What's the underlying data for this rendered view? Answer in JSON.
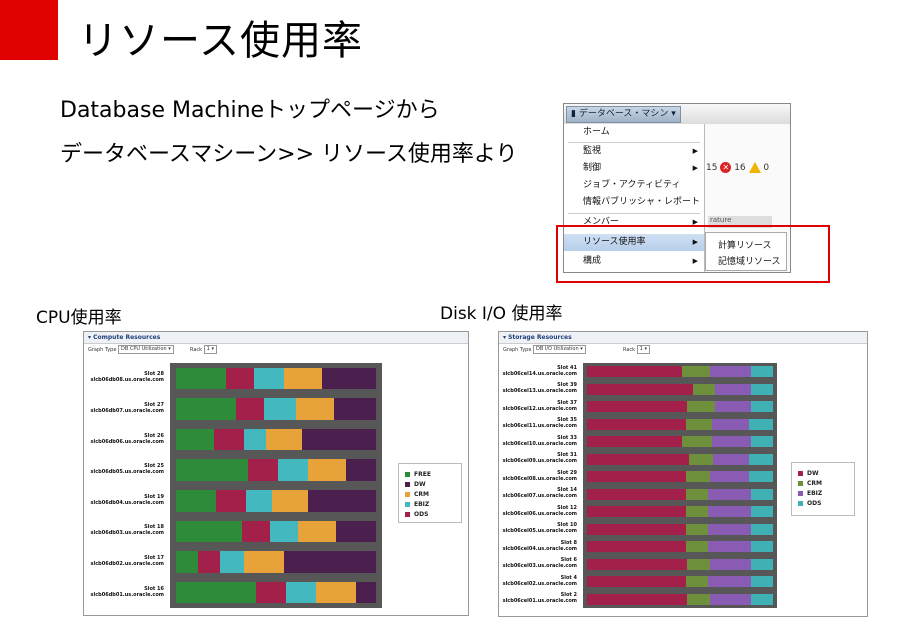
{
  "slide": {
    "title": "リソース使用率",
    "line1": "Database Machineトップページから",
    "line2": "データベースマシーン>> リソース使用率より",
    "cpu_caption": "CPU使用率",
    "disk_caption": "Disk I/O  使用率"
  },
  "menu": {
    "target_button": "データベース・マシン",
    "items": [
      {
        "label": "ホーム",
        "arrow": false
      },
      {
        "label": "監視",
        "arrow": true
      },
      {
        "label": "制御",
        "arrow": true
      },
      {
        "label": "ジョブ・アクティビティ",
        "arrow": false
      },
      {
        "label": "情報パブリッシャ・レポート",
        "arrow": false
      },
      {
        "label": "メンバー",
        "arrow": true
      },
      {
        "label": "リソース使用率",
        "arrow": true
      },
      {
        "label": "構成",
        "arrow": true
      }
    ],
    "submenu": [
      "計算リソース",
      "記憶域リソース"
    ],
    "status_a": "15",
    "status_b": "16",
    "status_c": "0",
    "partial_text": "rature"
  },
  "colors": {
    "accent_red": "#e00000",
    "free": "#2e8b3a",
    "dw": "#4b1f4e",
    "crm": "#e8a23a",
    "ebiz": "#44b8bf",
    "ods": "#a3204b",
    "storage_dw": "#a3204b",
    "storage_crm": "#6e8f3c",
    "storage_ebiz": "#8a5bb3",
    "storage_ods": "#3fb0b4"
  },
  "cpu_panel": {
    "header": "Compute Resources",
    "graph_type_label": "Graph Type",
    "graph_type_value": "DB CPU Utilization",
    "rack_label": "Rack",
    "rack_value": "1",
    "legend": [
      "FREE",
      "DW",
      "CRM",
      "EBIZ",
      "ODS"
    ]
  },
  "disk_panel": {
    "header": "Storage Resources",
    "graph_type_label": "Graph Type",
    "graph_type_value": "DB I/O Utilization",
    "rack_label": "Rack",
    "rack_value": "1",
    "legend": [
      "DW",
      "CRM",
      "EBIZ",
      "ODS"
    ]
  },
  "chart_data": [
    {
      "type": "bar",
      "title": "Compute Resources",
      "orientation": "horizontal-stacked",
      "categories": [
        "Slot 28 slcb06db08.us.oracle.com",
        "Slot 27 slcb06db07.us.oracle.com",
        "Slot 26 slcb06db06.us.oracle.com",
        "Slot 25 slcb06db05.us.oracle.com",
        "Slot 19 slcb06db04.us.oracle.com",
        "Slot 18 slcb06db03.us.oracle.com",
        "Slot 17 slcb06db02.us.oracle.com",
        "Slot 16 slcb06db01.us.oracle.com"
      ],
      "series": [
        {
          "name": "FREE",
          "values": [
            25,
            30,
            19,
            36,
            20,
            33,
            11,
            40
          ]
        },
        {
          "name": "ODS",
          "values": [
            14,
            14,
            15,
            15,
            15,
            14,
            11,
            15
          ]
        },
        {
          "name": "EBIZ",
          "values": [
            15,
            16,
            11,
            15,
            13,
            14,
            12,
            15
          ]
        },
        {
          "name": "CRM",
          "values": [
            19,
            19,
            18,
            19,
            18,
            19,
            20,
            20
          ]
        },
        {
          "name": "DW",
          "values": [
            27,
            21,
            37,
            15,
            34,
            20,
            46,
            10
          ]
        }
      ],
      "xlim": [
        0,
        100
      ],
      "legend_position": "right"
    },
    {
      "type": "bar",
      "title": "Storage Resources",
      "orientation": "horizontal-stacked",
      "categories": [
        "Slot 41 slcb06cel14.us.oracle.com",
        "Slot 39 slcb06cel13.us.oracle.com",
        "Slot 37 slcb06cel12.us.oracle.com",
        "Slot 35 slcb06cel11.us.oracle.com",
        "Slot 33 slcb06cel10.us.oracle.com",
        "Slot 31 slcb06cel09.us.oracle.com",
        "Slot 29 slcb06cel08.us.oracle.com",
        "Slot 14 slcb06cel07.us.oracle.com",
        "Slot 12 slcb06cel06.us.oracle.com",
        "Slot 10 slcb06cel05.us.oracle.com",
        "Slot 8 slcb06cel04.us.oracle.com",
        "Slot 6 slcb06cel03.us.oracle.com",
        "Slot 4 slcb06cel02.us.oracle.com",
        "Slot 2 slcb06cel01.us.oracle.com"
      ],
      "series": [
        {
          "name": "DW",
          "values": [
            51,
            57,
            54,
            53,
            51,
            55,
            53,
            53,
            53,
            53,
            53,
            54,
            53,
            54
          ]
        },
        {
          "name": "CRM",
          "values": [
            15,
            12,
            15,
            14,
            16,
            13,
            13,
            12,
            12,
            12,
            12,
            12,
            12,
            12
          ]
        },
        {
          "name": "EBIZ",
          "values": [
            22,
            19,
            19,
            20,
            21,
            19,
            21,
            23,
            23,
            23,
            23,
            22,
            23,
            22
          ]
        },
        {
          "name": "ODS",
          "values": [
            12,
            12,
            12,
            13,
            12,
            13,
            13,
            12,
            12,
            12,
            12,
            12,
            12,
            12
          ]
        }
      ],
      "xlim": [
        0,
        100
      ],
      "legend_position": "right"
    }
  ]
}
